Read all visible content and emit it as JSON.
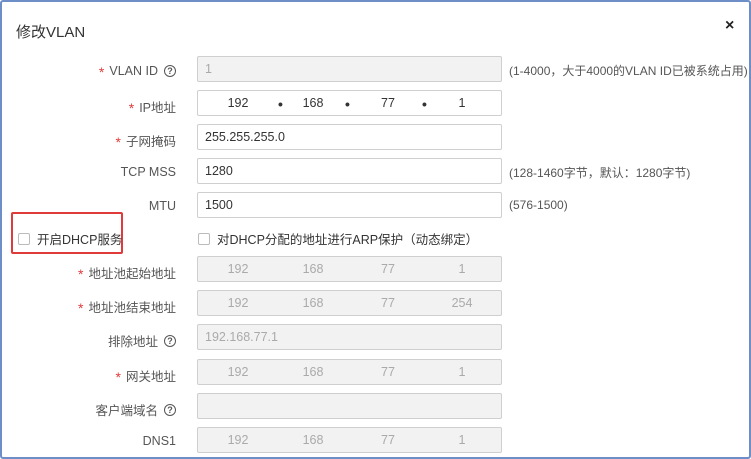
{
  "dialog": {
    "title": "修改VLAN",
    "close": "×"
  },
  "fields": {
    "vlan_id": {
      "label": "VLAN ID",
      "value": "1",
      "hint": "(1-4000，大于4000的VLAN ID已被系统占用)"
    },
    "ip": {
      "label": "IP地址",
      "octets": [
        "192",
        "168",
        "77",
        "1"
      ]
    },
    "mask": {
      "label": "子网掩码",
      "value": "255.255.255.0"
    },
    "tcp_mss": {
      "label": "TCP MSS",
      "value": "1280",
      "hint": "(128-1460字节，默认：1280字节)"
    },
    "mtu": {
      "label": "MTU",
      "value": "1500",
      "hint": "(576-1500)"
    },
    "dhcp": {
      "label": "开启DHCP服务",
      "checked": false
    },
    "arp": {
      "label": "对DHCP分配的地址进行ARP保护（动态绑定）",
      "checked": false
    },
    "pool_start": {
      "label": "地址池起始地址",
      "octets": [
        "192",
        "168",
        "77",
        "1"
      ]
    },
    "pool_end": {
      "label": "地址池结束地址",
      "octets": [
        "192",
        "168",
        "77",
        "254"
      ]
    },
    "exclude": {
      "label": "排除地址",
      "placeholder": "192.168.77.1"
    },
    "gateway": {
      "label": "网关地址",
      "octets": [
        "192",
        "168",
        "77",
        "1"
      ]
    },
    "domain": {
      "label": "客户端域名",
      "value": ""
    },
    "dns1": {
      "label": "DNS1",
      "octets": [
        "192",
        "168",
        "77",
        "1"
      ]
    }
  },
  "icons": {
    "help": "question-circle-icon",
    "required": "asterisk"
  },
  "colors": {
    "frame": "#6d8ec7",
    "highlight": "#e03b3b",
    "required": "#e23a3a"
  }
}
